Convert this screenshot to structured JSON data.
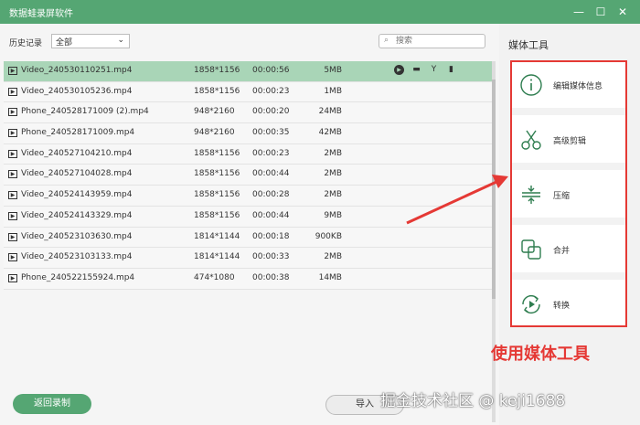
{
  "window": {
    "title": "数据蛙录屏软件",
    "controls": {
      "minimize": "—",
      "maximize": "☐",
      "close": "✕"
    }
  },
  "filter": {
    "label": "历史记录",
    "selected": "全部",
    "search_placeholder": "搜索"
  },
  "files": [
    {
      "name": "Video_240530110251.mp4",
      "resolution": "1858*1156",
      "duration": "00:00:56",
      "size": "5MB",
      "selected": true
    },
    {
      "name": "Video_240530105236.mp4",
      "resolution": "1858*1156",
      "duration": "00:00:23",
      "size": "1MB"
    },
    {
      "name": "Phone_240528171009 (2).mp4",
      "resolution": "948*2160",
      "duration": "00:00:20",
      "size": "24MB"
    },
    {
      "name": "Phone_240528171009.mp4",
      "resolution": "948*2160",
      "duration": "00:00:35",
      "size": "42MB"
    },
    {
      "name": "Video_240527104210.mp4",
      "resolution": "1858*1156",
      "duration": "00:00:23",
      "size": "2MB"
    },
    {
      "name": "Video_240527104028.mp4",
      "resolution": "1858*1156",
      "duration": "00:00:44",
      "size": "2MB"
    },
    {
      "name": "Video_240524143959.mp4",
      "resolution": "1858*1156",
      "duration": "00:00:28",
      "size": "2MB"
    },
    {
      "name": "Video_240524143329.mp4",
      "resolution": "1858*1156",
      "duration": "00:00:44",
      "size": "9MB"
    },
    {
      "name": "Video_240523103630.mp4",
      "resolution": "1814*1144",
      "duration": "00:00:18",
      "size": "900KB"
    },
    {
      "name": "Video_240523103133.mp4",
      "resolution": "1814*1144",
      "duration": "00:00:33",
      "size": "2MB"
    },
    {
      "name": "Phone_240522155924.mp4",
      "resolution": "474*1080",
      "duration": "00:00:38",
      "size": "14MB"
    }
  ],
  "row_actions": [
    "play-icon",
    "folder-icon",
    "edit-tools-icon",
    "delete-icon"
  ],
  "buttons": {
    "back": "返回录制",
    "import": "导入"
  },
  "media_tools": {
    "title": "媒体工具",
    "items": [
      {
        "label": "编辑媒体信息",
        "icon": "info-icon"
      },
      {
        "label": "高级剪辑",
        "icon": "scissors-icon"
      },
      {
        "label": "压缩",
        "icon": "compress-icon"
      },
      {
        "label": "合并",
        "icon": "merge-icon"
      },
      {
        "label": "转换",
        "icon": "convert-icon"
      }
    ]
  },
  "annotation": "使用媒体工具",
  "watermark": "掘金技术社区 @ keji1688",
  "colors": {
    "brand": "#55a673",
    "selected_row": "#a9d5b7",
    "annotation": "#e53935",
    "icon": "#2e7d4f"
  }
}
